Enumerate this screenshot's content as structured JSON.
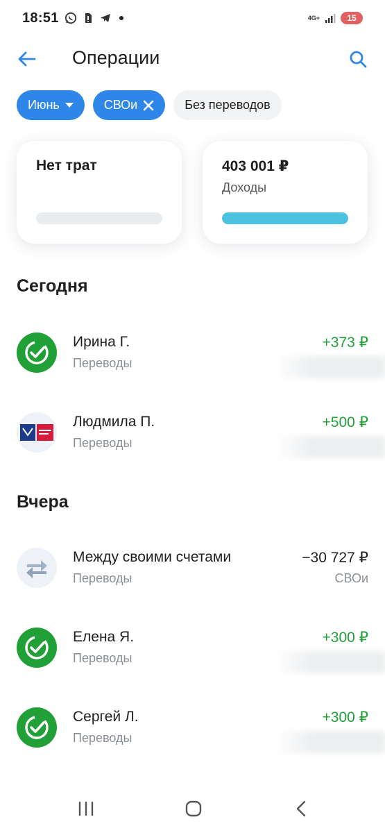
{
  "status_bar": {
    "time": "18:51",
    "network": "4G+",
    "battery": "15",
    "icons": [
      "whatsapp-icon",
      "sim-icon",
      "telegram-icon"
    ]
  },
  "header": {
    "title": "Операции",
    "back_icon": "arrow-left-icon",
    "search_icon": "search-icon"
  },
  "filters": {
    "month": "Июнь",
    "account": "СВОи",
    "transfers": "Без переводов"
  },
  "cards": {
    "expenses": {
      "title": "Нет трат",
      "progress": 0
    },
    "income": {
      "amount": "403 001 ₽",
      "label": "Доходы",
      "progress": 1.0,
      "color": "#4bc3e0"
    }
  },
  "sections": {
    "today": "Сегодня",
    "yesterday": "Вчера"
  },
  "transactions": [
    {
      "name": "Ирина Г.",
      "category": "Переводы",
      "amount": "+373 ₽",
      "icon": "sber-check-icon"
    },
    {
      "name": "Людмила П.",
      "category": "Переводы",
      "amount": "+500 ₽",
      "icon": "pochta-bank-logo"
    },
    {
      "name": "Между своими счетами",
      "category": "Переводы",
      "amount": "−30 727 ₽",
      "account": "СВОи",
      "icon": "transfer-arrows-icon"
    },
    {
      "name": "Елена Я.",
      "category": "Переводы",
      "amount": "+300 ₽",
      "icon": "sber-check-icon"
    },
    {
      "name": "Сергей Л.",
      "category": "Переводы",
      "amount": "+300 ₽",
      "icon": "sber-check-icon"
    }
  ],
  "colors": {
    "accent": "#2f86e9",
    "income": "#21a038",
    "progress_income": "#4bc3e0"
  },
  "nav": {
    "recent_icon": "recent-apps-icon",
    "home_icon": "home-icon",
    "back_icon": "nav-back-icon"
  }
}
